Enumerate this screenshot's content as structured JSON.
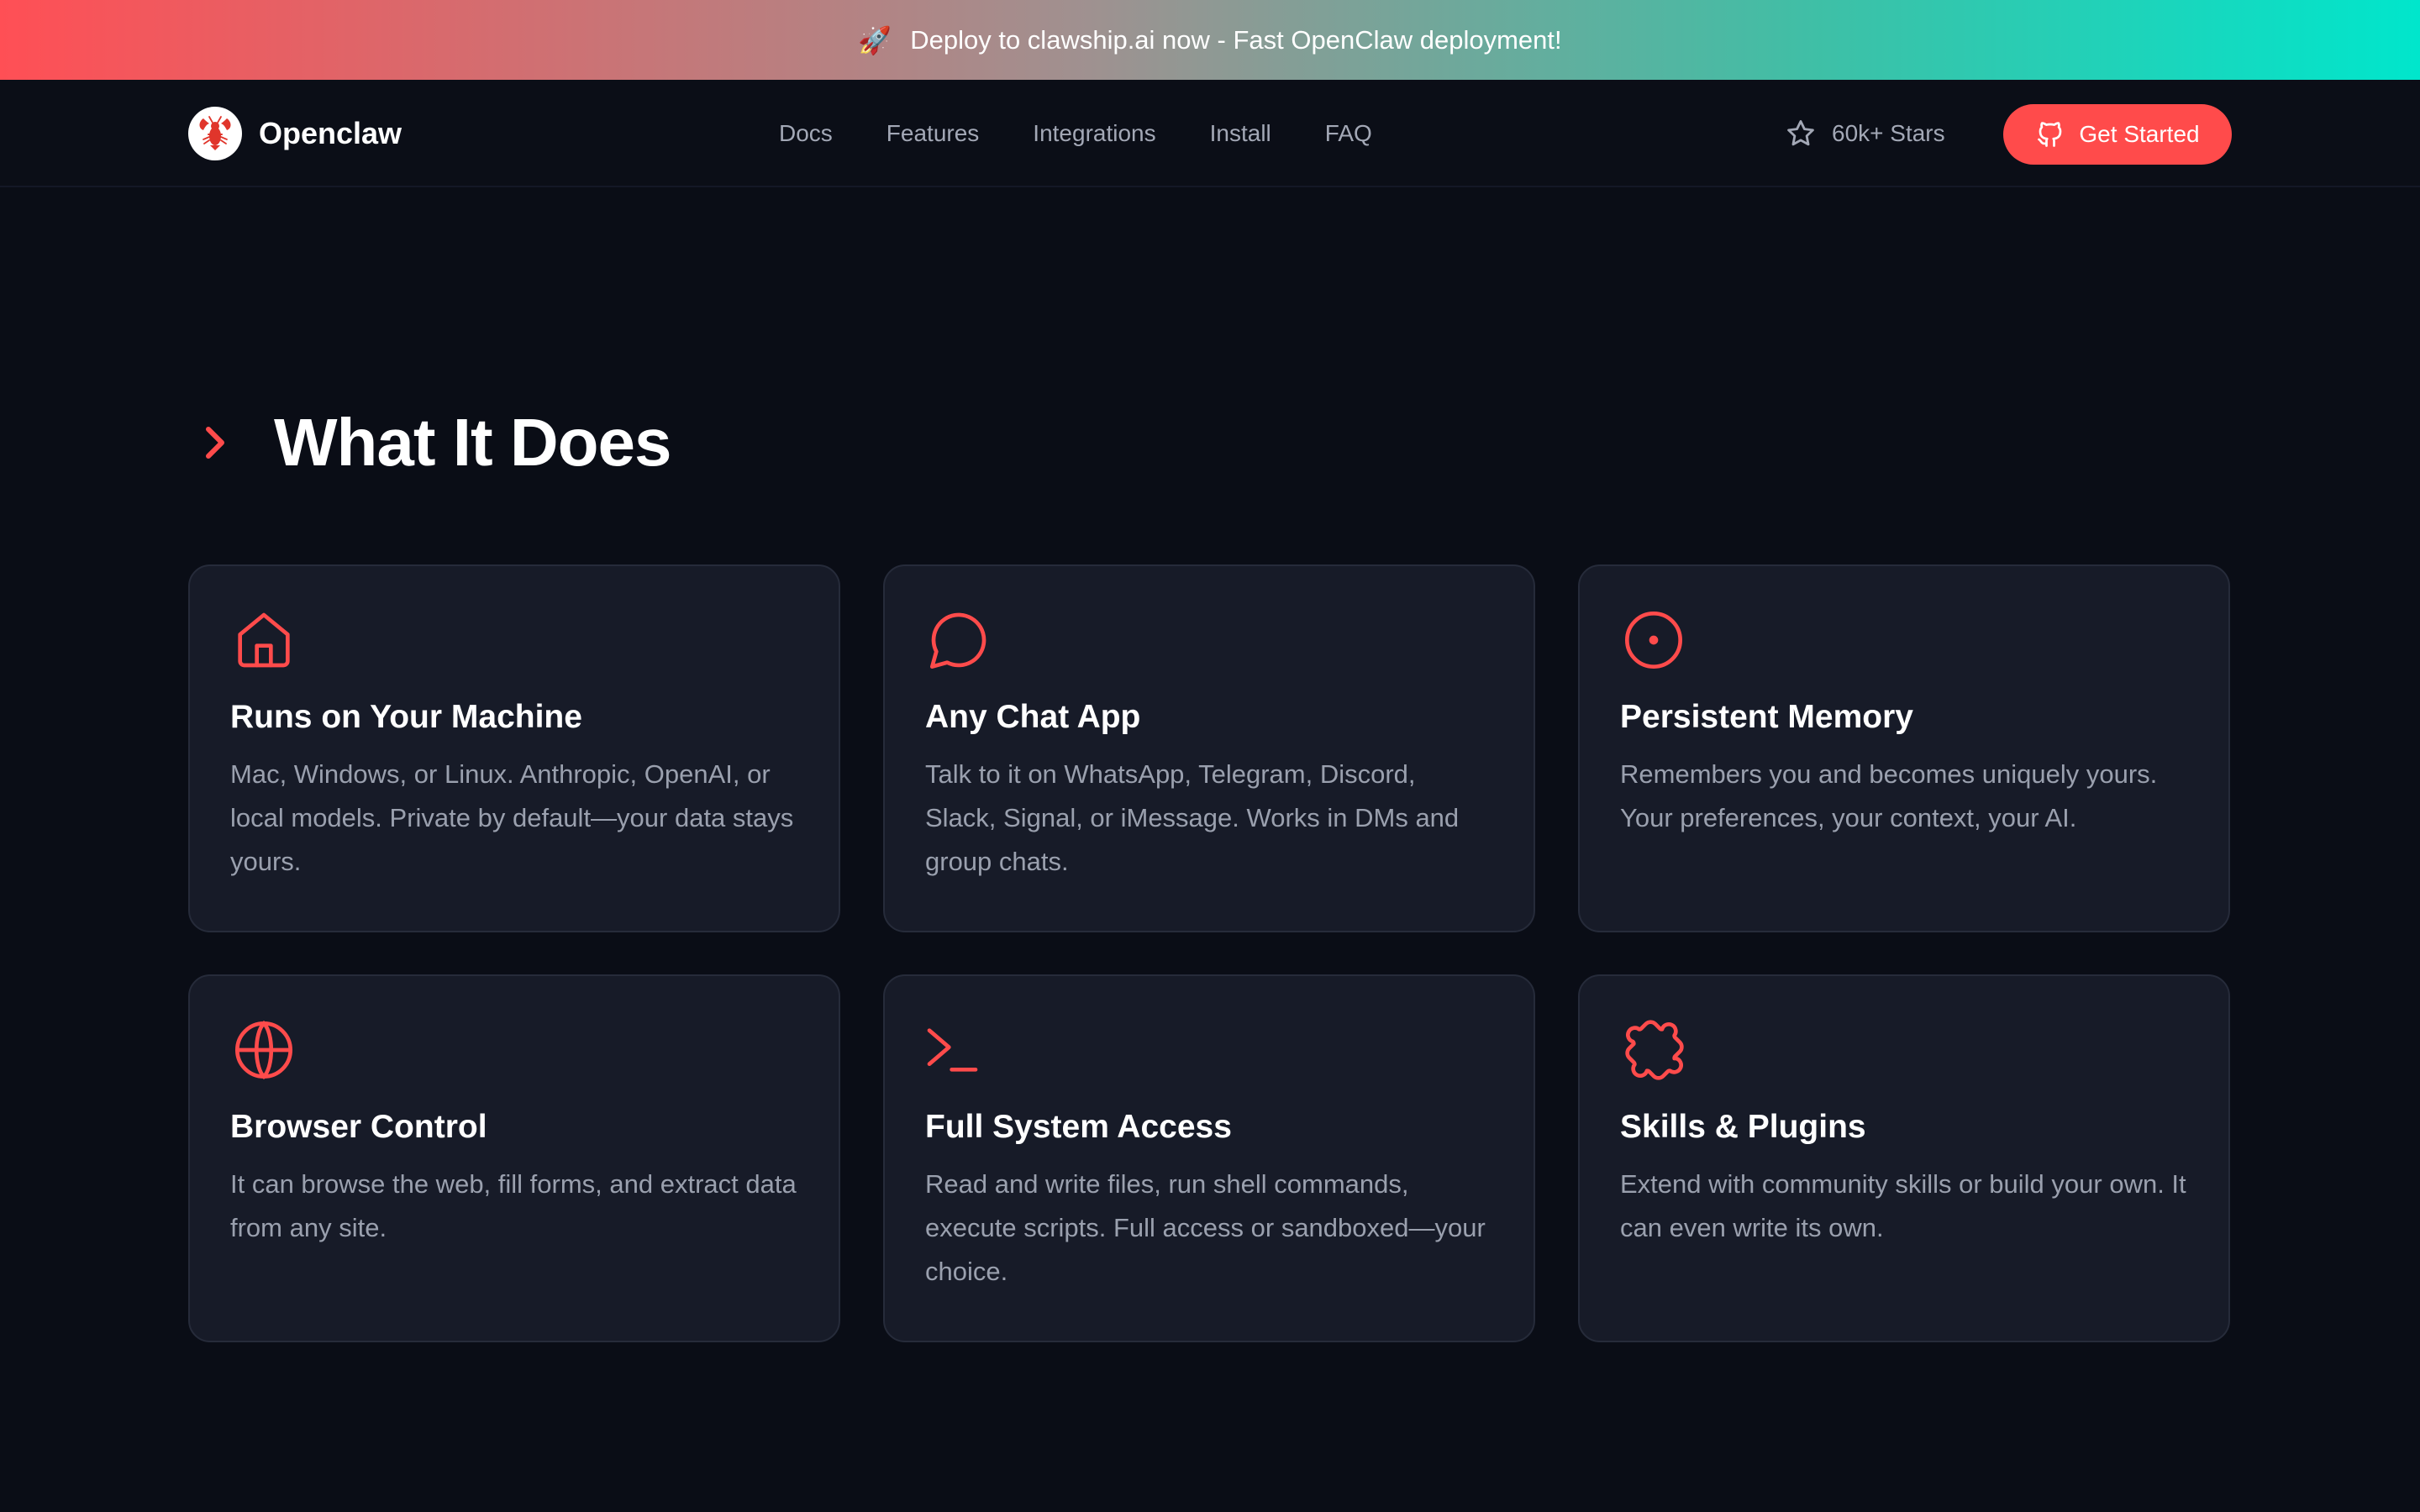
{
  "banner": {
    "icon": "rocket-icon",
    "text": "Deploy to clawship.ai now - Fast OpenClaw deployment!"
  },
  "nav": {
    "logo_icon": "lobster-icon",
    "logo_text": "Openclaw",
    "links": [
      "Docs",
      "Features",
      "Integrations",
      "Install",
      "FAQ"
    ],
    "stars_icon": "star-icon",
    "stars_text": "60k+ Stars",
    "cta_icon": "github-icon",
    "cta_label": "Get Started"
  },
  "section": {
    "icon": "chevron-right-icon",
    "title": "What It Does"
  },
  "features": [
    {
      "icon": "home-icon",
      "title": "Runs on Your Machine",
      "description": "Mac, Windows, or Linux. Anthropic, OpenAI, or local models. Private by default—your data stays yours."
    },
    {
      "icon": "chat-bubble-icon",
      "title": "Any Chat App",
      "description": "Talk to it on WhatsApp, Telegram, Discord, Slack, Signal, or iMessage. Works in DMs and group chats."
    },
    {
      "icon": "circle-dot-icon",
      "title": "Persistent Memory",
      "description": "Remembers you and becomes uniquely yours. Your preferences, your context, your AI."
    },
    {
      "icon": "globe-icon",
      "title": "Browser Control",
      "description": "It can browse the web, fill forms, and extract data from any site."
    },
    {
      "icon": "terminal-icon",
      "title": "Full System Access",
      "description": "Read and write files, run shell commands, execute scripts. Full access or sandboxed—your choice."
    },
    {
      "icon": "puzzle-icon",
      "title": "Skills & Plugins",
      "description": "Extend with community skills or build your own. It can even write its own."
    }
  ],
  "colors": {
    "accent": "#ff4b4b",
    "background": "#0a0d16",
    "card": "#171b28",
    "muted_text": "#9aa0ae"
  }
}
